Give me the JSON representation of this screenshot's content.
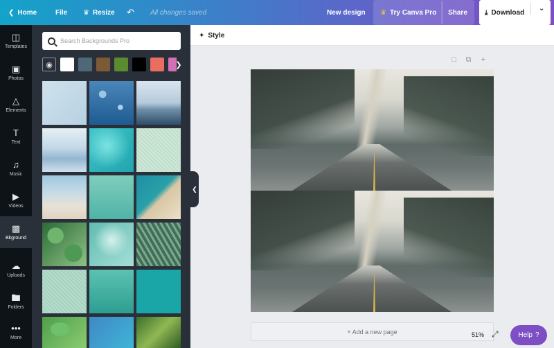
{
  "topbar": {
    "home_label": "Home",
    "file_label": "File",
    "resize_label": "Resize",
    "saved_status": "All changes saved",
    "new_design_label": "New design",
    "try_pro_label": "Try Canva Pro",
    "share_label": "Share",
    "download_label": "Download"
  },
  "rail": {
    "items": [
      {
        "label": "Templates",
        "icon": "layout-icon"
      },
      {
        "label": "Photos",
        "icon": "image-icon"
      },
      {
        "label": "Elements",
        "icon": "shapes-icon"
      },
      {
        "label": "Text",
        "icon": "text-icon"
      },
      {
        "label": "Music",
        "icon": "music-note-icon"
      },
      {
        "label": "Videos",
        "icon": "video-icon"
      },
      {
        "label": "Bkground",
        "icon": "hatch-icon"
      },
      {
        "label": "Uploads",
        "icon": "cloud-upload-icon"
      },
      {
        "label": "Folders",
        "icon": "folder-icon"
      },
      {
        "label": "More",
        "icon": "dots-icon"
      }
    ],
    "active_index": 6
  },
  "panel": {
    "search_placeholder": "Search Backgrounds Pro",
    "swatches": [
      "#ffffff",
      "#4e6877",
      "#7d5a36",
      "#5c8a2e",
      "#000000",
      "#e86f5f",
      "#d56fb3"
    ]
  },
  "editor": {
    "style_label": "Style",
    "add_page_label": "+ Add a new page",
    "zoom_level": "51%",
    "help_label": "Help",
    "help_glyph": "?"
  },
  "colors": {
    "accent": "#7d4ec4",
    "panel_bg": "#293039",
    "rail_bg": "#0e1318"
  }
}
